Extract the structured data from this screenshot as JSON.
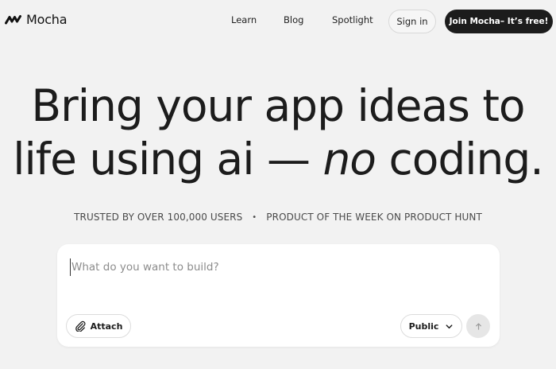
{
  "header": {
    "logo_text": "Mocha",
    "nav": {
      "learn": "Learn",
      "blog": "Blog",
      "spotlight": "Spotlight"
    },
    "signin_label": "Sign in",
    "join_label": "Join Mocha– It’s free!"
  },
  "hero": {
    "line1": "Bring your app ideas to",
    "line2_start": "life using ai — ",
    "line2_emphasis": "no",
    "line2_end": " coding."
  },
  "trust": {
    "left": "TRUSTED BY OVER 100,000 USERS",
    "separator": "•",
    "right": "PRODUCT OF THE WEEK ON PRODUCT HUNT"
  },
  "prompt": {
    "placeholder": "What do you want to build?",
    "value": "",
    "attach_label": "Attach",
    "visibility_label": "Public"
  },
  "icons": {
    "logo": "mocha-wave-icon",
    "attach": "paperclip-icon",
    "visibility": "chevron-down-icon",
    "send": "arrow-up-icon"
  },
  "colors": {
    "background": "#f2f2f2",
    "primary": "#1c1c1c",
    "card": "#ffffff",
    "send_disabled": "#e6e6e6"
  }
}
